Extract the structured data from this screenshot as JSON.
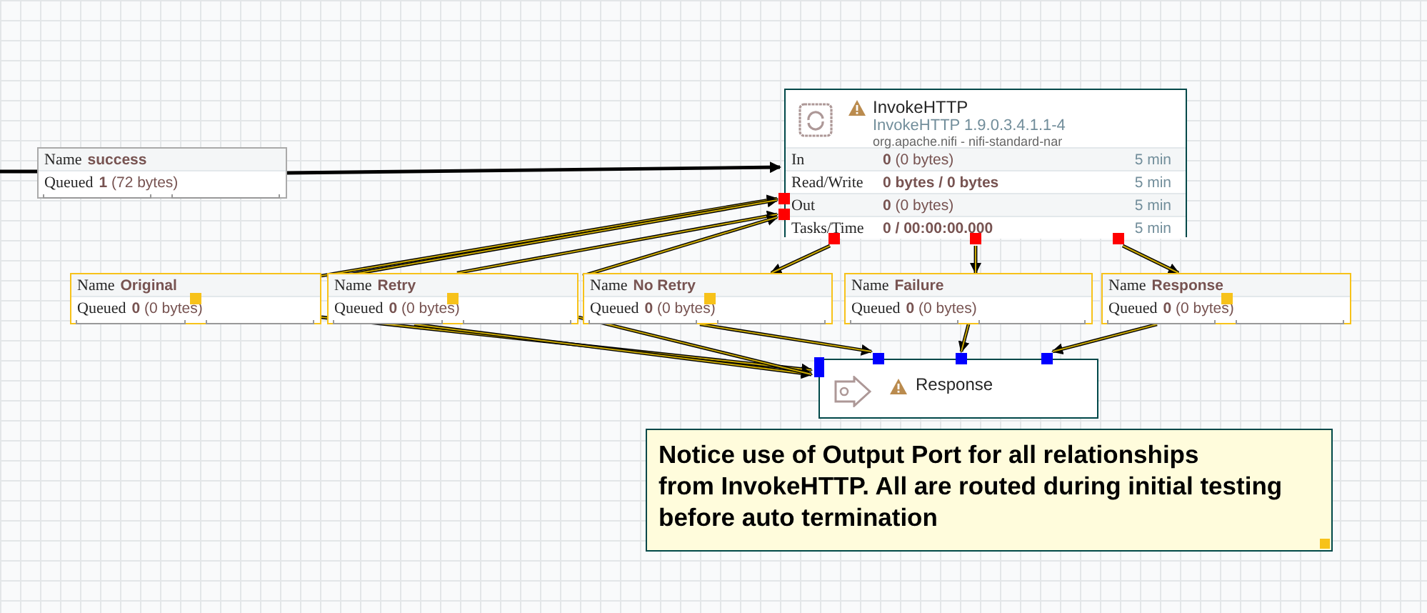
{
  "processor": {
    "name": "InvokeHTTP",
    "warning": true,
    "type_version": "InvokeHTTP 1.9.0.3.4.1.1-4",
    "bundle": "org.apache.nifi - nifi-standard-nar",
    "stats": [
      {
        "label": "In",
        "count": "0",
        "size": "(0 bytes)",
        "time": "5 min"
      },
      {
        "label": "Read/Write",
        "count": "0 bytes / 0 bytes",
        "time": "5 min"
      },
      {
        "label": "Out",
        "count": "0",
        "size": "(0 bytes)",
        "time": "5 min"
      },
      {
        "label": "Tasks/Time",
        "count": "0 / 00:00:00.000",
        "time": "5 min"
      }
    ]
  },
  "connections": [
    {
      "name_label": "Name",
      "name": "success",
      "queued_label": "Queued",
      "count": "1",
      "size": "(72 bytes)",
      "selected": false
    },
    {
      "name_label": "Name",
      "name": "Original",
      "queued_label": "Queued",
      "count": "0",
      "size": "(0 bytes)",
      "selected": true
    },
    {
      "name_label": "Name",
      "name": "Retry",
      "queued_label": "Queued",
      "count": "0",
      "size": "(0 bytes)",
      "selected": true
    },
    {
      "name_label": "Name",
      "name": "No Retry",
      "queued_label": "Queued",
      "count": "0",
      "size": "(0 bytes)",
      "selected": true
    },
    {
      "name_label": "Name",
      "name": "Failure",
      "queued_label": "Queued",
      "count": "0",
      "size": "(0 bytes)",
      "selected": true
    },
    {
      "name_label": "Name",
      "name": "Response",
      "queued_label": "Queued",
      "count": "0",
      "size": "(0 bytes)",
      "selected": true
    }
  ],
  "output_port": {
    "name": "Response",
    "warning": true
  },
  "note": {
    "text": "Notice use of Output Port for all relationships\nfrom InvokeHTTP. All are routed during initial testing\nbefore auto termination"
  }
}
